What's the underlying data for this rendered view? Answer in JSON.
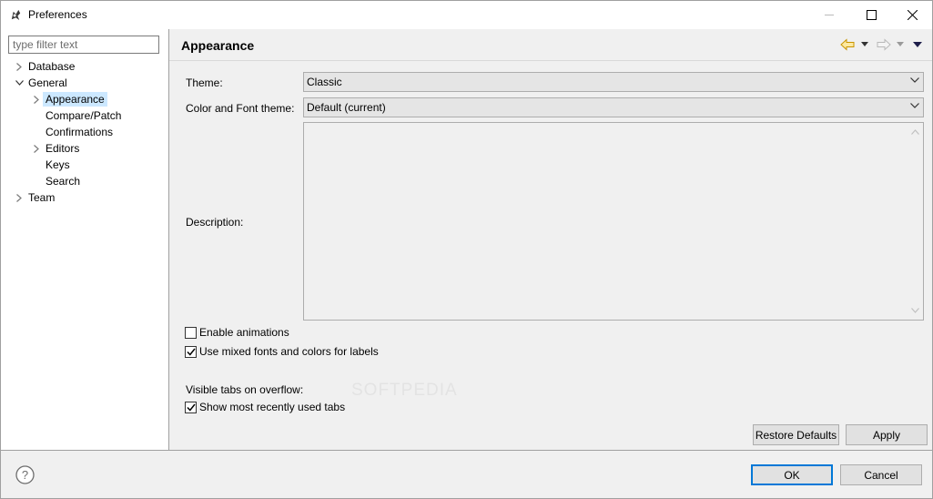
{
  "window": {
    "title": "Preferences"
  },
  "filter": {
    "placeholder": "type filter text"
  },
  "tree": {
    "items": [
      {
        "label": "Database",
        "level": 0,
        "expander": "collapsed"
      },
      {
        "label": "General",
        "level": 0,
        "expander": "expanded"
      },
      {
        "label": "Appearance",
        "level": 1,
        "expander": "collapsed",
        "selected": true
      },
      {
        "label": "Compare/Patch",
        "level": 1,
        "expander": "none"
      },
      {
        "label": "Confirmations",
        "level": 1,
        "expander": "none"
      },
      {
        "label": "Editors",
        "level": 1,
        "expander": "collapsed"
      },
      {
        "label": "Keys",
        "level": 1,
        "expander": "none"
      },
      {
        "label": "Search",
        "level": 1,
        "expander": "none"
      },
      {
        "label": "Team",
        "level": 0,
        "expander": "collapsed"
      }
    ]
  },
  "page": {
    "title": "Appearance",
    "nav_back_icon": "back-arrow-icon",
    "nav_forward_icon": "forward-arrow-icon",
    "menu_icon": "view-menu-icon"
  },
  "form": {
    "theme_label": "Theme:",
    "theme_value": "Classic",
    "color_font_label": "Color and Font theme:",
    "color_font_value": "Default (current)",
    "description_label": "Description:",
    "enable_animations_label": "Enable animations",
    "enable_animations_checked": false,
    "mixed_fonts_label": "Use mixed fonts and colors for labels",
    "mixed_fonts_checked": true,
    "visible_tabs_label": "Visible tabs on overflow:",
    "show_recent_tabs_label": "Show most recently used tabs",
    "show_recent_tabs_checked": true
  },
  "watermark": "SOFTPEDIA",
  "buttons": {
    "restore_defaults": "Restore Defaults",
    "apply": "Apply",
    "ok": "OK",
    "cancel": "Cancel"
  },
  "colors": {
    "accent": "#0078d7",
    "selection": "#cce8ff",
    "back_arrow": "#e8b400"
  }
}
